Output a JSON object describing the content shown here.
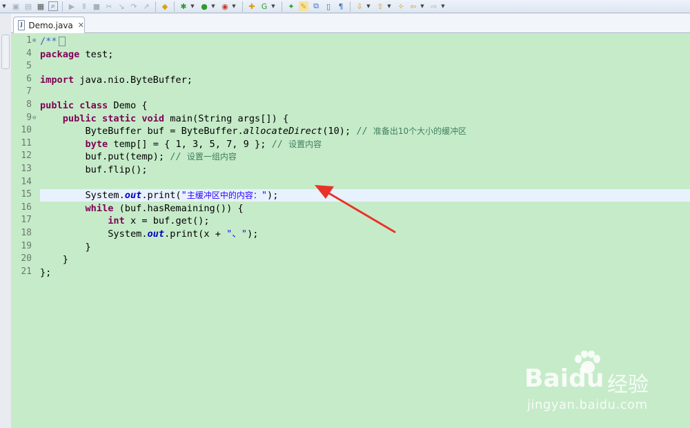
{
  "tab": {
    "title": "Demo.java",
    "close_glyph": "✕",
    "file_icon": "J"
  },
  "code_lines": [
    {
      "num": "1",
      "segments": [
        {
          "c": "jd",
          "t": "/**"
        }
      ]
    },
    {
      "num": "4",
      "segments": [
        {
          "c": "kw",
          "t": "package"
        },
        {
          "c": "",
          "t": " test;"
        }
      ]
    },
    {
      "num": "5",
      "segments": []
    },
    {
      "num": "6",
      "segments": [
        {
          "c": "kw",
          "t": "import"
        },
        {
          "c": "",
          "t": " java.nio.ByteBuffer;"
        }
      ]
    },
    {
      "num": "7",
      "segments": []
    },
    {
      "num": "8",
      "segments": [
        {
          "c": "kw",
          "t": "public"
        },
        {
          "c": "",
          "t": " "
        },
        {
          "c": "kw",
          "t": "class"
        },
        {
          "c": "",
          "t": " Demo {"
        }
      ]
    },
    {
      "num": "9",
      "segments": [
        {
          "c": "",
          "t": "    "
        },
        {
          "c": "kw",
          "t": "public"
        },
        {
          "c": "",
          "t": " "
        },
        {
          "c": "kw",
          "t": "static"
        },
        {
          "c": "",
          "t": " "
        },
        {
          "c": "kw",
          "t": "void"
        },
        {
          "c": "",
          "t": " main(String args[]) {"
        }
      ]
    },
    {
      "num": "10",
      "segments": [
        {
          "c": "",
          "t": "        ByteBuffer buf = ByteBuffer."
        },
        {
          "c": "it",
          "t": "allocateDirect"
        },
        {
          "c": "",
          "t": "(10); "
        },
        {
          "c": "cm",
          "t": "// "
        },
        {
          "c": "cmz",
          "t": "准备出10个大小的缓冲区"
        }
      ]
    },
    {
      "num": "11",
      "segments": [
        {
          "c": "",
          "t": "        "
        },
        {
          "c": "kw",
          "t": "byte"
        },
        {
          "c": "",
          "t": " temp[] = { 1, 3, 5, 7, 9 }; "
        },
        {
          "c": "cm",
          "t": "// "
        },
        {
          "c": "cmz",
          "t": "设置内容"
        }
      ]
    },
    {
      "num": "12",
      "segments": [
        {
          "c": "",
          "t": "        buf.put(temp); "
        },
        {
          "c": "cm",
          "t": "// "
        },
        {
          "c": "cmz",
          "t": "设置一组内容"
        }
      ]
    },
    {
      "num": "13",
      "segments": [
        {
          "c": "",
          "t": "        buf.flip();"
        }
      ]
    },
    {
      "num": "14",
      "segments": []
    },
    {
      "num": "15",
      "segments": [
        {
          "c": "",
          "t": "        System."
        },
        {
          "c": "fld",
          "t": "out"
        },
        {
          "c": "",
          "t": ".print("
        },
        {
          "c": "st",
          "t": "\""
        },
        {
          "c": "stz",
          "t": "主缓冲区中的内容："
        },
        {
          "c": "st",
          "t": "\""
        },
        {
          "c": "",
          "t": ");"
        }
      ]
    },
    {
      "num": "16",
      "segments": [
        {
          "c": "",
          "t": "        "
        },
        {
          "c": "kw",
          "t": "while"
        },
        {
          "c": "",
          "t": " (buf.hasRemaining()) {"
        }
      ]
    },
    {
      "num": "17",
      "segments": [
        {
          "c": "",
          "t": "            "
        },
        {
          "c": "kw",
          "t": "int"
        },
        {
          "c": "",
          "t": " x = buf.get();"
        }
      ]
    },
    {
      "num": "18",
      "segments": [
        {
          "c": "",
          "t": "            System."
        },
        {
          "c": "fld",
          "t": "out"
        },
        {
          "c": "",
          "t": ".print(x + "
        },
        {
          "c": "st",
          "t": "\"、\""
        },
        {
          "c": "",
          "t": ");"
        }
      ]
    },
    {
      "num": "19",
      "segments": [
        {
          "c": "",
          "t": "        }"
        }
      ]
    },
    {
      "num": "20",
      "segments": [
        {
          "c": "",
          "t": "    }"
        }
      ]
    },
    {
      "num": "21",
      "segments": [
        {
          "c": "",
          "t": "};"
        }
      ]
    }
  ],
  "current_line_number": "15",
  "folded_markers": {
    "line1": "⊕",
    "line9": "⊖"
  },
  "watermark": {
    "brand": "Bai",
    "brand_suffix": "du",
    "product": "经验",
    "url": "jingyan.baidu.com"
  },
  "colors": {
    "editor_bg": "#c6ebc9",
    "keyword": "#7f0055",
    "comment": "#3f7f5f",
    "string": "#2a00ff",
    "arrow": "#e8332a",
    "current_line": "#e8f2fe"
  },
  "toolbar_icons": [
    "drop-arrow",
    "save-icon",
    "save-all-icon",
    "print-icon",
    "search-icon",
    "resume-icon",
    "suspend-icon",
    "terminate-icon",
    "disconnect-icon",
    "step-into-icon",
    "step-over-icon",
    "step-return-icon",
    "drop-to-frame-icon",
    "run-to-line-icon",
    "debug-icon",
    "run-icon",
    "external-tools-icon",
    "new-java-project-icon",
    "new-class-icon",
    "open-type-icon",
    "toggle-mark-icon",
    "annotation-icon",
    "next-annotation-icon",
    "prev-annotation-icon",
    "back-icon",
    "forward-icon"
  ]
}
